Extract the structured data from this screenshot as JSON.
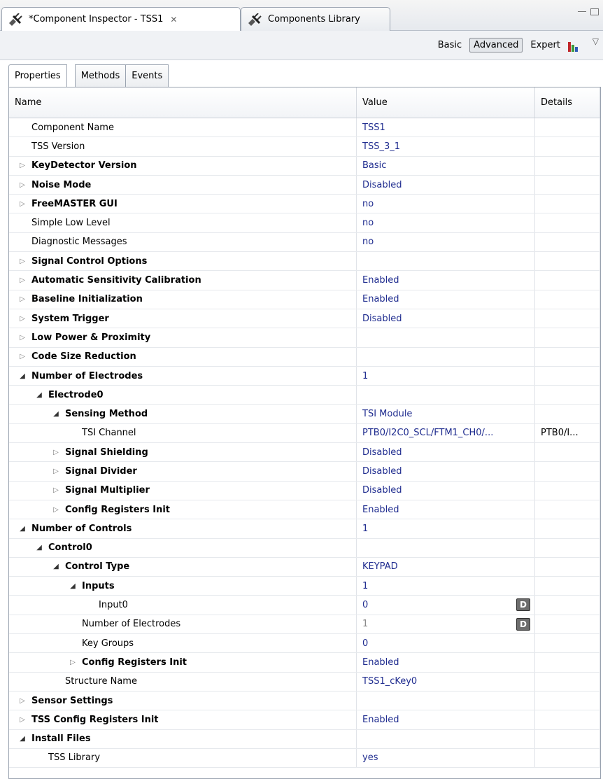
{
  "editor_tabs": [
    {
      "label": "*Component Inspector - TSS1",
      "close": "✕"
    },
    {
      "label": "Components Library"
    }
  ],
  "toolbar": {
    "modes": [
      "Basic",
      "Advanced",
      "Expert"
    ],
    "selected_mode": "Advanced"
  },
  "subtabs": [
    "Properties",
    "Methods",
    "Events"
  ],
  "table": {
    "headers": {
      "name": "Name",
      "value": "Value",
      "details": "Details"
    },
    "rows": [
      {
        "label": "Component Name",
        "value": "TSS1",
        "details": "",
        "level": 0,
        "expander": "",
        "bold": false
      },
      {
        "label": "TSS Version",
        "value": "TSS_3_1",
        "details": "",
        "level": 0,
        "expander": "",
        "bold": false
      },
      {
        "label": "KeyDetector Version",
        "value": "Basic",
        "details": "",
        "level": 0,
        "expander": "closed",
        "bold": true
      },
      {
        "label": "Noise Mode",
        "value": "Disabled",
        "details": "",
        "level": 0,
        "expander": "closed",
        "bold": true
      },
      {
        "label": "FreeMASTER GUI",
        "value": "no",
        "details": "",
        "level": 0,
        "expander": "closed",
        "bold": true
      },
      {
        "label": "Simple Low Level",
        "value": "no",
        "details": "",
        "level": 0,
        "expander": "",
        "bold": false
      },
      {
        "label": "Diagnostic Messages",
        "value": "no",
        "details": "",
        "level": 0,
        "expander": "",
        "bold": false
      },
      {
        "label": "Signal Control Options",
        "value": "",
        "details": "",
        "level": 0,
        "expander": "closed",
        "bold": true
      },
      {
        "label": "Automatic Sensitivity Calibration",
        "value": "Enabled",
        "details": "",
        "level": 0,
        "expander": "closed",
        "bold": true
      },
      {
        "label": "Baseline Initialization",
        "value": "Enabled",
        "details": "",
        "level": 0,
        "expander": "closed",
        "bold": true
      },
      {
        "label": "System Trigger",
        "value": "Disabled",
        "details": "",
        "level": 0,
        "expander": "closed",
        "bold": true
      },
      {
        "label": "Low Power & Proximity",
        "value": "",
        "details": "",
        "level": 0,
        "expander": "closed",
        "bold": true
      },
      {
        "label": "Code Size Reduction",
        "value": "",
        "details": "",
        "level": 0,
        "expander": "closed",
        "bold": true
      },
      {
        "label": "Number of Electrodes",
        "value": "1",
        "details": "",
        "level": 0,
        "expander": "open",
        "bold": true
      },
      {
        "label": "Electrode0",
        "value": "",
        "details": "",
        "level": 1,
        "expander": "open",
        "bold": true
      },
      {
        "label": "Sensing Method",
        "value": "TSI Module",
        "details": "",
        "level": 2,
        "expander": "open",
        "bold": true
      },
      {
        "label": "TSI Channel",
        "value": "PTB0/I2C0_SCL/FTM1_CH0/...",
        "details": "PTB0/I...",
        "level": 3,
        "expander": "",
        "bold": false
      },
      {
        "label": "Signal Shielding",
        "value": "Disabled",
        "details": "",
        "level": 2,
        "expander": "closed",
        "bold": true
      },
      {
        "label": "Signal Divider",
        "value": "Disabled",
        "details": "",
        "level": 2,
        "expander": "closed",
        "bold": true
      },
      {
        "label": "Signal Multiplier",
        "value": "Disabled",
        "details": "",
        "level": 2,
        "expander": "closed",
        "bold": true
      },
      {
        "label": "Config Registers Init",
        "value": "Enabled",
        "details": "",
        "level": 2,
        "expander": "closed",
        "bold": true
      },
      {
        "label": "Number of Controls",
        "value": "1",
        "details": "",
        "level": 0,
        "expander": "open",
        "bold": true
      },
      {
        "label": "Control0",
        "value": "",
        "details": "",
        "level": 1,
        "expander": "open",
        "bold": true
      },
      {
        "label": "Control Type",
        "value": "KEYPAD",
        "details": "",
        "level": 2,
        "expander": "open",
        "bold": true
      },
      {
        "label": "Inputs",
        "value": "1",
        "details": "",
        "level": 3,
        "expander": "open",
        "bold": true
      },
      {
        "label": "Input0",
        "value": "0",
        "details": "",
        "level": 4,
        "expander": "",
        "bold": false,
        "dbutton": "D"
      },
      {
        "label": "Number of Electrodes",
        "value": "1",
        "details": "",
        "level": 3,
        "expander": "",
        "bold": false,
        "dbutton": "D",
        "gray": true
      },
      {
        "label": "Key Groups",
        "value": "0",
        "details": "",
        "level": 3,
        "expander": "",
        "bold": false
      },
      {
        "label": "Config Registers Init",
        "value": "Enabled",
        "details": "",
        "level": 3,
        "expander": "closed",
        "bold": true
      },
      {
        "label": "Structure Name",
        "value": "TSS1_cKey0",
        "details": "",
        "level": 2,
        "expander": "",
        "bold": false
      },
      {
        "label": "Sensor Settings",
        "value": "",
        "details": "",
        "level": 0,
        "expander": "closed",
        "bold": true
      },
      {
        "label": "TSS Config Registers Init",
        "value": "Enabled",
        "details": "",
        "level": 0,
        "expander": "closed",
        "bold": true
      },
      {
        "label": "Install Files",
        "value": "",
        "details": "",
        "level": 0,
        "expander": "open",
        "bold": true
      },
      {
        "label": "TSS Library",
        "value": "yes",
        "details": "",
        "level": 1,
        "expander": "",
        "bold": false
      }
    ]
  },
  "icons": {
    "component": "plug-icon",
    "library": "plug-icon",
    "chart": "bar-chart-icon",
    "menu": "view-menu-icon"
  },
  "colors": {
    "value_text": "#1f2c8f",
    "disabled_value": "#888888"
  }
}
